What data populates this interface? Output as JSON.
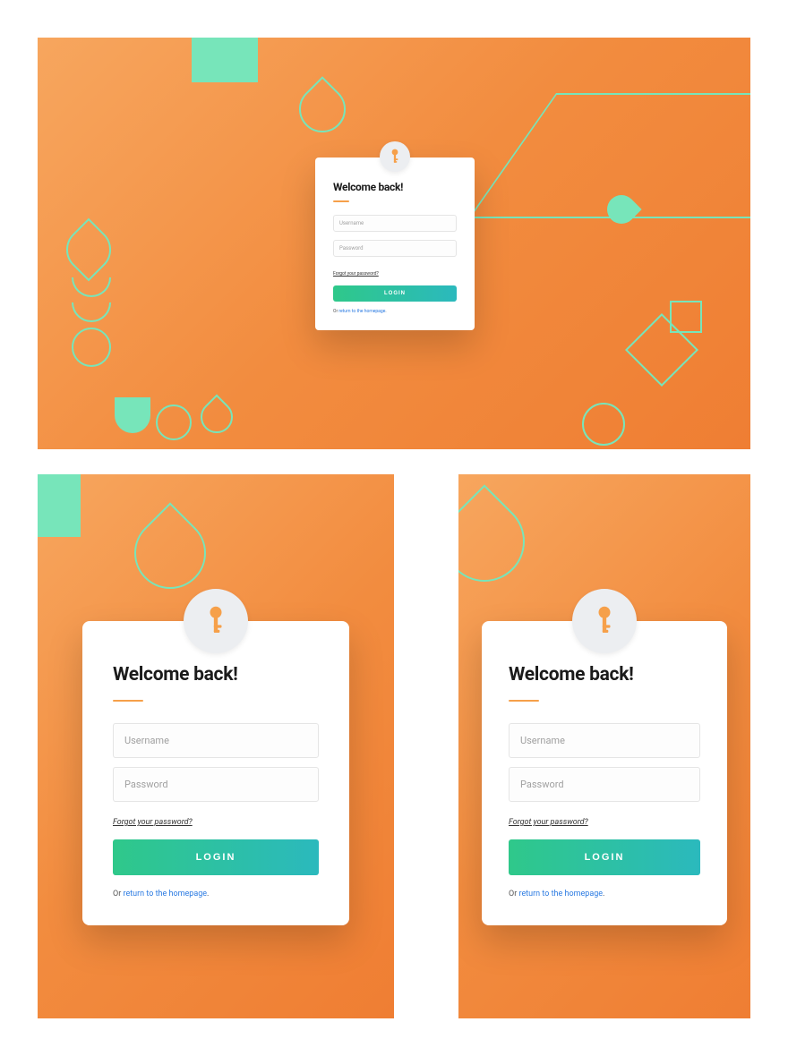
{
  "card": {
    "heading": "Welcome back!",
    "username_placeholder": "Username",
    "password_placeholder": "Password",
    "forgot_label": "Forgot your password?",
    "login_label": "LOGIN",
    "return_prefix": "Or ",
    "return_link": "return to the homepage",
    "return_suffix": "."
  },
  "colors": {
    "accent_orange": "#f6a04a",
    "accent_teal": "#77e5ba",
    "button_grad_start": "#2fc88a",
    "button_grad_end": "#2bb9bd",
    "link": "#2a7ae2"
  },
  "icons": {
    "key": "key-icon"
  }
}
